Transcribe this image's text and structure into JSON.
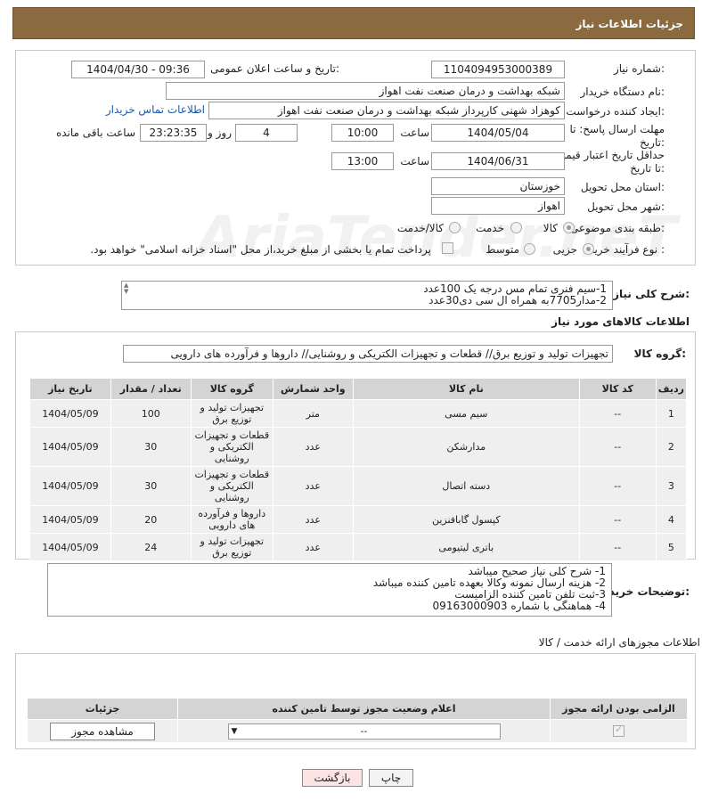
{
  "header": {
    "title": "جزئیات اطلاعات نیاز"
  },
  "watermark": {
    "text": "AriaTender.neT"
  },
  "form": {
    "need_number_label": "شماره نیاز:",
    "need_number": "1104094953000389",
    "announce_label": "تاریخ و ساعت اعلان عمومی:",
    "announce_value": "1404/04/30 - 09:36",
    "buyer_org_label": "نام دستگاه خریدار:",
    "buyer_org": "شبکه بهداشت و درمان صنعت نفت اهواز",
    "requester_label": "ایجاد کننده درخواست:",
    "requester": "کوهزاد شهنی کارپرداز شبکه بهداشت و درمان صنعت نفت اهواز",
    "contact_link": "اطلاعات تماس خریدار",
    "deadline_label": "مهلت ارسال پاسخ: تا تاریخ:",
    "deadline_date": "1404/05/04",
    "time_label": "ساعت",
    "deadline_time": "10:00",
    "days": "4",
    "days_label": "روز و",
    "remaining": "23:23:35",
    "remaining_label": "ساعت باقی مانده",
    "validity_label": "حداقل تاریخ اعتبار قیمت: تا تاریخ:",
    "validity_date": "1404/06/31",
    "validity_time": "13:00",
    "province_label": "استان محل تحویل:",
    "province": "خوزستان",
    "city_label": "شهر محل تحویل:",
    "city": "اهواز",
    "category_label": "طبقه بندی موضوعی:",
    "category_options": [
      "کالا",
      "خدمت",
      "کالا/خدمت"
    ],
    "process_label": "نوع فرآیند خرید :",
    "process_options": [
      "جزیی",
      "متوسط"
    ],
    "payment_note": "پرداخت تمام یا بخشی از مبلغ خرید،از محل \"اسناد خزانه اسلامی\" خواهد بود."
  },
  "summary": {
    "label": "شرح کلی نیاز:",
    "lines": [
      "1-سیم فنری تمام مس درجه یک 100عدد",
      "2-مدار7705به همراه ال سی دی30عدد"
    ]
  },
  "goods_section": {
    "title": "اطلاعات کالاهای مورد نیاز"
  },
  "goods_group": {
    "label": "گروه کالا:",
    "value": "تجهیزات تولید و توزیع برق// قطعات و تجهیزات الکتریکی و روشنایی// داروها و فرآورده های دارویی"
  },
  "table": {
    "headers": [
      "ردیف",
      "کد کالا",
      "نام کالا",
      "واحد شمارش",
      "گروه کالا",
      "تعداد / مقدار",
      "تاریخ نیاز"
    ],
    "rows": [
      {
        "idx": "1",
        "code": "--",
        "name": "سیم مسی",
        "unit": "متر",
        "group": "تجهیزات تولید و توزیع برق",
        "qty": "100",
        "date": "1404/05/09"
      },
      {
        "idx": "2",
        "code": "--",
        "name": "مدارشکن",
        "unit": "عدد",
        "group": "قطعات و تجهیزات الکتریکی و روشنایی",
        "qty": "30",
        "date": "1404/05/09"
      },
      {
        "idx": "3",
        "code": "--",
        "name": "دسته اتصال",
        "unit": "عدد",
        "group": "قطعات و تجهیزات الکتریکی و روشنایی",
        "qty": "30",
        "date": "1404/05/09"
      },
      {
        "idx": "4",
        "code": "--",
        "name": "کپسول گابافنزین",
        "unit": "عدد",
        "group": "داروها و فرآورده های دارویی",
        "qty": "20",
        "date": "1404/05/09"
      },
      {
        "idx": "5",
        "code": "--",
        "name": "باتری لیتیومی",
        "unit": "عدد",
        "group": "تجهیزات تولید و توزیع برق",
        "qty": "24",
        "date": "1404/05/09"
      }
    ]
  },
  "buyer_notes": {
    "label": "توضیحات خریدار:",
    "lines": [
      "1- شرح کلی نیاز صحیح میباشد",
      "2- هزینه ارسال نمونه وکالا بعهده تامین کننده میباشد",
      "3-ثبت تلفن تامین کننده الزامیست",
      "4- هماهنگی با شماره 09163000903"
    ]
  },
  "permits": {
    "title": "اطلاعات مجوزهای ارائه خدمت / کالا",
    "headers": [
      "الزامی بودن ارائه مجوز",
      "اعلام وضعیت مجوز توسط تامین کننده",
      "جزئیات"
    ],
    "select_value": "--",
    "view_button": "مشاهده مجوز"
  },
  "buttons": {
    "print": "چاپ",
    "back": "بازگشت"
  }
}
